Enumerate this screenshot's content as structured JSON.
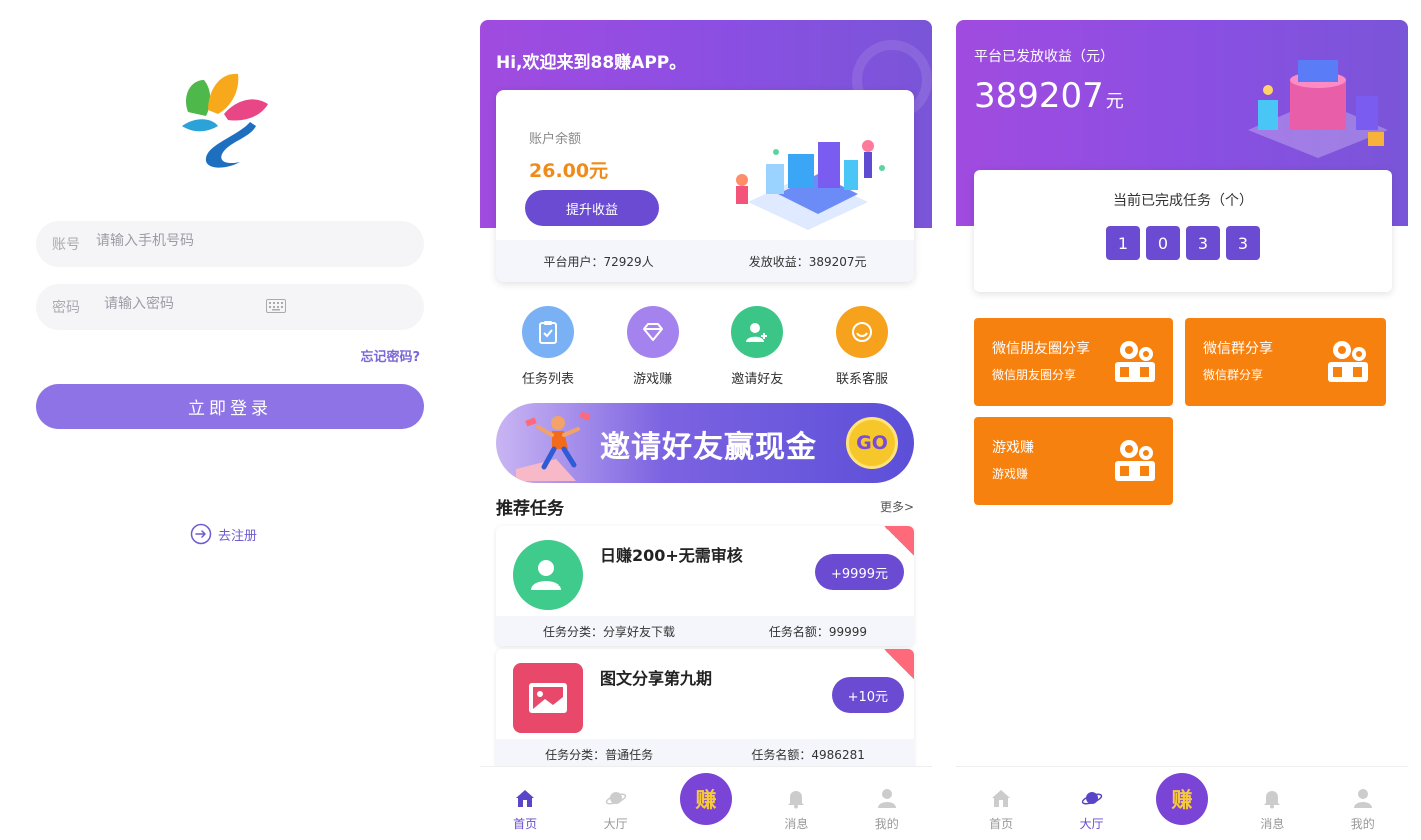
{
  "login": {
    "account_label": "账号",
    "account_placeholder": "请输入手机号码",
    "password_label": "密码",
    "password_placeholder": "请输入密码",
    "forgot": "忘记密码?",
    "login_button": "立即登录",
    "register": "去注册"
  },
  "home": {
    "welcome": "Hi,欢迎来到88赚APP。",
    "balance_label": "账户余额",
    "balance_value": "26.00元",
    "upgrade_button": "提升收益",
    "stat_users": "平台用户：72929人",
    "stat_paid": "发放收益：389207元",
    "menu": [
      {
        "label": "任务列表",
        "color": "#7ab0f4"
      },
      {
        "label": "游戏赚",
        "color": "#a583ee"
      },
      {
        "label": "邀请好友",
        "color": "#3bc688"
      },
      {
        "label": "联系客服",
        "color": "#f7a21d"
      }
    ],
    "banner_text": "邀请好友赢现金",
    "banner_go": "GO",
    "section_title": "推荐任务",
    "section_more": "更多>",
    "tasks": [
      {
        "name": "日赚200+无需审核",
        "reward": "+9999元",
        "category": "任务分类：分享好友下载",
        "quota": "任务名额：99999",
        "color": "#3ecb8c"
      },
      {
        "name": "图文分享第九期",
        "reward": "+10元",
        "category": "任务分类：普通任务",
        "quota": "任务名额：4986281",
        "color": "#e8496a"
      }
    ]
  },
  "tabs": {
    "home": "首页",
    "hall": "大厅",
    "earn": "赚",
    "messages": "消息",
    "mine": "我的"
  },
  "hall": {
    "earn_label": "平台已发放收益（元）",
    "earn_value": "389207",
    "earn_unit": "元",
    "count_title": "当前已完成任务（个）",
    "digits": [
      "1",
      "0",
      "3",
      "3"
    ],
    "cards": [
      {
        "title": "微信朋友圈分享",
        "subtitle": "微信朋友圈分享"
      },
      {
        "title": "微信群分享",
        "subtitle": "微信群分享"
      },
      {
        "title": "游戏赚",
        "subtitle": "游戏赚"
      }
    ]
  },
  "colors": {
    "accent": "#6a4bd1",
    "login_button": "#8e73e6",
    "hero_start": "#a14be0",
    "orange_card": "#f7810f",
    "balance": "#f08a19"
  }
}
